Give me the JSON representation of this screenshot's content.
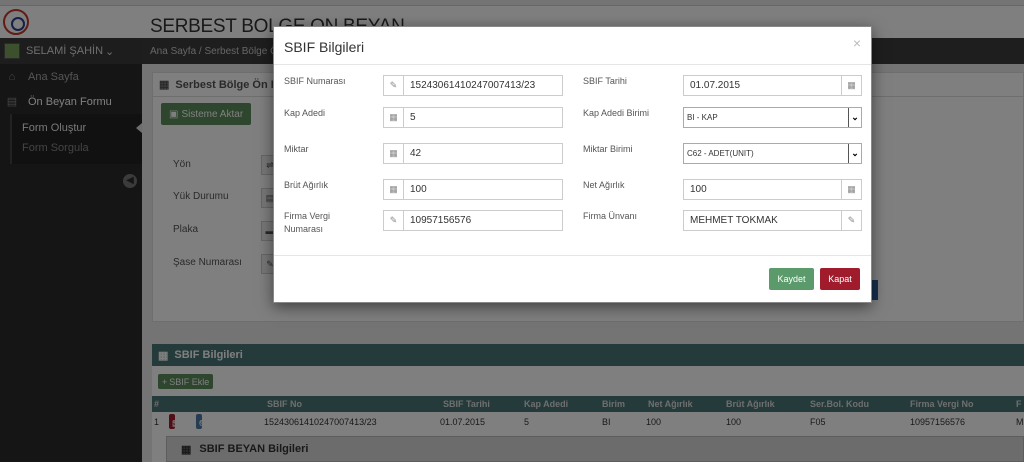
{
  "header": {
    "title": "SERBEST BOLGE ON BEYAN"
  },
  "sidebar": {
    "user": "SELAMİ ŞAHİN",
    "items": [
      {
        "label": "Ana Sayfa",
        "icon": "home-icon"
      },
      {
        "label": "Ön Beyan Formu",
        "icon": "file-icon"
      }
    ],
    "sub_items": [
      {
        "label": "Form Oluştur"
      },
      {
        "label": "Form Sorgula"
      }
    ]
  },
  "breadcrumb": {
    "text": "Ana Sayfa /  Serbest Bölge Ön"
  },
  "panel": {
    "title": "Serbest Bölge Ön Beya",
    "aktar_label": "Sisteme Aktar",
    "fields": [
      "Yön",
      "Yük Durumu",
      "Plaka",
      "Şase Numarası"
    ]
  },
  "sbif": {
    "title": "SBIF Bilgileri",
    "add_label": "SBIF Ekle",
    "columns": [
      "#",
      "SBIF No",
      "SBIF Tarihi",
      "Kap Adedi",
      "Birim",
      "Net Ağırlık",
      "Brüt Ağırlık",
      "Ser.Bol. Kodu",
      "Firma Vergi No",
      "F"
    ],
    "row": {
      "num": "1",
      "delete_label": "Sil",
      "update_label": "Güncelle",
      "sbif_no": "15243061410247007413/23",
      "tarih": "01.07.2015",
      "kap": "5",
      "birim": "BI",
      "net": "100",
      "brut": "100",
      "kod": "F05",
      "vergi": "10957156576",
      "firma": "M"
    },
    "beyan_title": "SBIF BEYAN Bilgileri"
  },
  "modal": {
    "title": "SBIF Bilgileri",
    "close_glyph": "×",
    "sbif_no_label": "SBIF Numarası",
    "sbif_no": "15243061410247007413/23",
    "sbif_tarih_label": "SBIF Tarihi",
    "sbif_tarih": "01.07.2015",
    "kap_adedi_label": "Kap Adedi",
    "kap_adedi": "5",
    "kap_birimi_label": "Kap Adedi Birimi",
    "kap_birimi": "BI - KAP",
    "miktar_label": "Miktar",
    "miktar": "42",
    "miktar_birimi_label": "Miktar Birimi",
    "miktar_birimi": "C62 - ADET(UNIT)",
    "brut_label": "Brüt Ağırlık",
    "brut": "100",
    "net_label": "Net Ağırlık",
    "net": "100",
    "vergi_label_1": "Firma Vergi",
    "vergi_label_2": "Numarası",
    "vergi": "10957156576",
    "unvan_label": "Firma Ünvanı",
    "unvan": "MEHMET TOKMAK",
    "save_label": "Kaydet",
    "close_label": "Kapat"
  },
  "colors": {
    "accent_green": "#5b8c5a",
    "danger": "#a01c2c",
    "teal_header": "#4a7575"
  }
}
